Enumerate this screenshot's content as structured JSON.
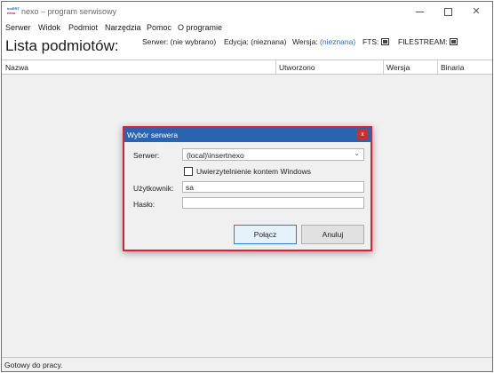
{
  "window": {
    "title": "nexo – program serwisowy",
    "icon_top": "insERT",
    "icon_bottom": "nexo"
  },
  "menu": [
    "Serwer",
    "Widok",
    "Podmiot",
    "Narzędzia",
    "Pomoc",
    "O programie"
  ],
  "header": {
    "title": "Lista podmiotów:",
    "server_label": "Serwer:",
    "server_value": "(nie wybrano)",
    "edition_label": "Edycja:",
    "edition_value": "(nieznana)",
    "version_label": "Wersja:",
    "version_value": "(nieznana)",
    "fts_label": "FTS:",
    "filestream_label": "FILESTREAM:"
  },
  "table": {
    "columns": [
      "Nazwa",
      "Utworzono",
      "Wersja",
      "Binaria"
    ]
  },
  "status": "Gotowy do pracy.",
  "dialog": {
    "title": "Wybór serwera",
    "close": "x",
    "server_label": "Serwer:",
    "server_value": "(local)\\insertnexo",
    "windows_auth_label": "Uwierzytelnienie kontem Windows",
    "windows_auth_checked": false,
    "user_label": "Użytkownik:",
    "user_value": "sa",
    "password_label": "Hasło:",
    "password_value": "",
    "connect_label": "Połącz",
    "cancel_label": "Anuluj"
  },
  "icons": {
    "dropdown": "chevron-down-icon",
    "minimize": "minimize-icon",
    "maximize": "maximize-icon",
    "close": "close-icon"
  },
  "colors": {
    "dialog_titlebar": "#2a63b0",
    "dialog_border": "#d9232e",
    "link": "#2b6cc4"
  }
}
